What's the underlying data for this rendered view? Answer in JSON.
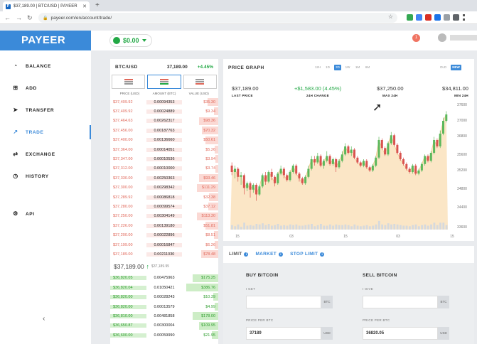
{
  "browser": {
    "tab_title": "$37,189.00 | BTC/USD | PAYEER",
    "tab_close": "✕",
    "new_tab": "+",
    "url": "payeer.com/en/account/trade/"
  },
  "sidebar": {
    "logo": "PAYEER",
    "items": [
      {
        "label": "BALANCE",
        "icon": "dashboard-icon"
      },
      {
        "label": "ADD",
        "icon": "add-icon"
      },
      {
        "label": "TRANSFER",
        "icon": "send-icon"
      },
      {
        "label": "TRADE",
        "icon": "trade-icon",
        "active": true
      },
      {
        "label": "EXCHANGE",
        "icon": "exchange-icon"
      },
      {
        "label": "HISTORY",
        "icon": "history-icon"
      },
      {
        "label": "API",
        "icon": "gear-icon"
      }
    ],
    "collapse": "‹"
  },
  "topbar": {
    "balance": "$0.00",
    "notifications": "1"
  },
  "order_book": {
    "pair": "BTC/USD",
    "last_price": "37,189.00",
    "change": "+4.45%",
    "columns": [
      "PRICE (USD)",
      "AMOUNT (BTC)",
      "VALUE (USD)"
    ],
    "asks": [
      {
        "price": "$37,409.92",
        "amount": "0.00094353",
        "value": "$35.30",
        "fill": 0.25
      },
      {
        "price": "$37,409.92",
        "amount": "0.00024889",
        "value": "$9.34",
        "fill": 0.1
      },
      {
        "price": "$37,464.63",
        "amount": "0.00262317",
        "value": "$98.36",
        "fill": 0.45
      },
      {
        "price": "$37,456.00",
        "amount": "0.00187763",
        "value": "$70.32",
        "fill": 0.38
      },
      {
        "price": "$37,400.00",
        "amount": "0.00136660",
        "value": "$50.61",
        "fill": 0.3
      },
      {
        "price": "$37,364.00",
        "amount": "0.00014051",
        "value": "$5.26",
        "fill": 0.08
      },
      {
        "price": "$37,347.00",
        "amount": "0.00010536",
        "value": "$3.94",
        "fill": 0.06
      },
      {
        "price": "$37,312.00",
        "amount": "0.00010000",
        "value": "$3.74",
        "fill": 0.06
      },
      {
        "price": "$37,330.00",
        "amount": "0.00250363",
        "value": "$93.46",
        "fill": 0.45
      },
      {
        "price": "$37,300.00",
        "amount": "0.00298342",
        "value": "$111.29",
        "fill": 0.5
      },
      {
        "price": "$37,289.92",
        "amount": "0.00086818",
        "value": "$32.38",
        "fill": 0.22
      },
      {
        "price": "$37,280.00",
        "amount": "0.00099574",
        "value": "$37.12",
        "fill": 0.24
      },
      {
        "price": "$37,250.00",
        "amount": "0.00304149",
        "value": "$113.30",
        "fill": 0.5
      },
      {
        "price": "$37,226.00",
        "amount": "0.00139180",
        "value": "$51.81",
        "fill": 0.3
      },
      {
        "price": "$37,200.00",
        "amount": "0.00022896",
        "value": "$8.51",
        "fill": 0.1
      },
      {
        "price": "$37,199.00",
        "amount": "0.00016847",
        "value": "$6.26",
        "fill": 0.08
      },
      {
        "price": "$37,189.00",
        "amount": "0.00211030",
        "value": "$78.48",
        "fill": 0.4
      }
    ],
    "mid_price": "$37,189.00",
    "mid_secondary": "$37,189.95",
    "bids": [
      {
        "price": "$36,820.05",
        "amount": "0.00475963",
        "value": "$175.25",
        "fill": 0.6
      },
      {
        "price": "$36,820.04",
        "amount": "0.01050421",
        "value": "$386.76",
        "fill": 0.75
      },
      {
        "price": "$36,820.00",
        "amount": "0.00028243",
        "value": "$10.39",
        "fill": 0.12
      },
      {
        "price": "$36,820.00",
        "amount": "0.00013579",
        "value": "$4.99",
        "fill": 0.08
      },
      {
        "price": "$36,810.00",
        "amount": "0.00481858",
        "value": "$178.00",
        "fill": 0.6
      },
      {
        "price": "$36,650.87",
        "amount": "0.00300004",
        "value": "$109.95",
        "fill": 0.45
      },
      {
        "price": "$36,600.00",
        "amount": "0.00059990",
        "value": "$21.95",
        "fill": 0.15
      }
    ]
  },
  "graph": {
    "title": "PRICE GRAPH",
    "periods": [
      "12H",
      "1D",
      "3D",
      "1W",
      "1M",
      "6M"
    ],
    "active_period": "3D",
    "modes": [
      "OLD",
      "NEW"
    ],
    "active_mode": "NEW",
    "stats": [
      {
        "value": "$37,189.00",
        "label": "LAST PRICE"
      },
      {
        "value": "+$1,583.00 (4.45%)",
        "label": "24H CHANGE"
      },
      {
        "value": "$37,250.00",
        "label": "MAX 24H"
      },
      {
        "value": "$34,811.00",
        "label": "MIN 24H"
      }
    ]
  },
  "chart_data": {
    "type": "candlestick",
    "y_ticks": [
      "37600",
      "37000",
      "36800",
      "35600",
      "35200",
      "34800",
      "34400",
      "33600"
    ],
    "x_ticks": [
      "15",
      "03",
      "15",
      "03",
      "15"
    ],
    "ylim": [
      33600,
      37600
    ],
    "candles": [
      [
        35600,
        35400,
        35700,
        35300
      ],
      [
        35400,
        35500,
        35600,
        35200
      ],
      [
        35500,
        35250,
        35550,
        35100
      ],
      [
        35250,
        35300,
        35400,
        35000
      ],
      [
        35300,
        34900,
        35350,
        34700
      ],
      [
        34900,
        35050,
        35100,
        34800
      ],
      [
        35050,
        34850,
        35100,
        34600
      ],
      [
        34850,
        35000,
        35050,
        34750
      ],
      [
        35000,
        34700,
        35050,
        34500
      ],
      [
        34700,
        34950,
        35000,
        34650
      ],
      [
        34950,
        35300,
        35350,
        34900
      ],
      [
        35300,
        35100,
        35400,
        35000
      ],
      [
        35100,
        35400,
        35450,
        35050
      ],
      [
        35400,
        35250,
        35500,
        35150
      ],
      [
        35250,
        35050,
        35300,
        34950
      ],
      [
        35050,
        35350,
        35400,
        35000
      ],
      [
        35350,
        35500,
        35600,
        35300
      ],
      [
        35500,
        35300,
        35550,
        35200
      ],
      [
        35300,
        35150,
        35350,
        35100
      ],
      [
        35150,
        35400,
        35450,
        35100
      ],
      [
        35400,
        35600,
        35650,
        35350
      ],
      [
        35600,
        35350,
        35650,
        35300
      ],
      [
        35350,
        35200,
        35400,
        35100
      ],
      [
        35200,
        35050,
        35250,
        35000
      ],
      [
        35050,
        35250,
        35300,
        35000
      ],
      [
        35250,
        35500,
        35600,
        35200
      ],
      [
        35500,
        35800,
        35900,
        35450
      ],
      [
        35800,
        35700,
        35900,
        35600
      ],
      [
        35700,
        35900,
        36000,
        35650
      ],
      [
        35900,
        35600,
        35950,
        35550
      ],
      [
        35600,
        35750,
        35800,
        35500
      ],
      [
        35750,
        35900,
        36050,
        35700
      ],
      [
        35900,
        35650,
        35950,
        35600
      ],
      [
        35650,
        35800,
        35850,
        35600
      ],
      [
        35800,
        35550,
        35850,
        35400
      ],
      [
        35550,
        35750,
        35800,
        35500
      ],
      [
        35750,
        35950,
        36050,
        35700
      ],
      [
        35950,
        36200,
        36300,
        35900
      ],
      [
        36200,
        36000,
        36250,
        35950
      ],
      [
        36000,
        36100,
        36200,
        35900
      ],
      [
        36100,
        35850,
        36150,
        35800
      ],
      [
        35850,
        35700,
        35900,
        35650
      ],
      [
        35700,
        35600,
        35750,
        35550
      ],
      [
        35600,
        35750,
        35800,
        35550
      ],
      [
        35750,
        35550,
        35800,
        35500
      ],
      [
        35550,
        35450,
        35600,
        35400
      ],
      [
        35450,
        35600,
        35650,
        35400
      ],
      [
        35600,
        35850,
        35900,
        35550
      ],
      [
        35850,
        36400,
        36500,
        35800
      ],
      [
        36400,
        36150,
        36450,
        36100
      ],
      [
        36150,
        35950,
        36200,
        35900
      ],
      [
        35950,
        36300,
        36350,
        35900
      ],
      [
        36300,
        36550,
        36650,
        36250
      ],
      [
        36550,
        36250,
        36600,
        36200
      ],
      [
        36250,
        36000,
        36300,
        35950
      ],
      [
        36000,
        35800,
        36050,
        35750
      ],
      [
        35800,
        35650,
        35850,
        35600
      ],
      [
        35650,
        35500,
        35700,
        35450
      ],
      [
        35500,
        35400,
        35550,
        35350
      ],
      [
        35400,
        35600,
        35650,
        35350
      ],
      [
        35600,
        35350,
        35650,
        35300
      ],
      [
        35350,
        35450,
        35500,
        35300
      ],
      [
        35450,
        35650,
        35700,
        35400
      ],
      [
        35650,
        35900,
        35950,
        35600
      ],
      [
        35900,
        35750,
        35950,
        35700
      ],
      [
        35750,
        36000,
        36050,
        35700
      ],
      [
        36000,
        36400,
        36500,
        35950
      ],
      [
        36400,
        36200,
        36450,
        36150
      ],
      [
        36200,
        36600,
        36700,
        36150
      ],
      [
        36600,
        37000,
        37100,
        36550
      ],
      [
        37000,
        37200,
        37300,
        36950
      ]
    ]
  },
  "trade_form": {
    "tabs": [
      "LIMIT",
      "MARKET",
      "STOP LIMIT"
    ],
    "active_tab": "MARKET",
    "buy": {
      "title": "BUY BITCOIN",
      "amount_label": "I GET",
      "amount_value": "",
      "amount_suffix": "BTC",
      "price_label": "PRICE PER BTC",
      "price_value": "37189",
      "price_suffix": "USD"
    },
    "sell": {
      "title": "SELL BITCOIN",
      "amount_label": "I GIVE",
      "amount_value": "",
      "amount_suffix": "BTC",
      "price_label": "PRICE PER BTC",
      "price_value": "36820.05",
      "price_suffix": "USD"
    }
  },
  "colors": {
    "brand": "#3b8ad9",
    "up": "#5cb85c",
    "down": "#d9534f",
    "area": "#fbe3c0"
  }
}
